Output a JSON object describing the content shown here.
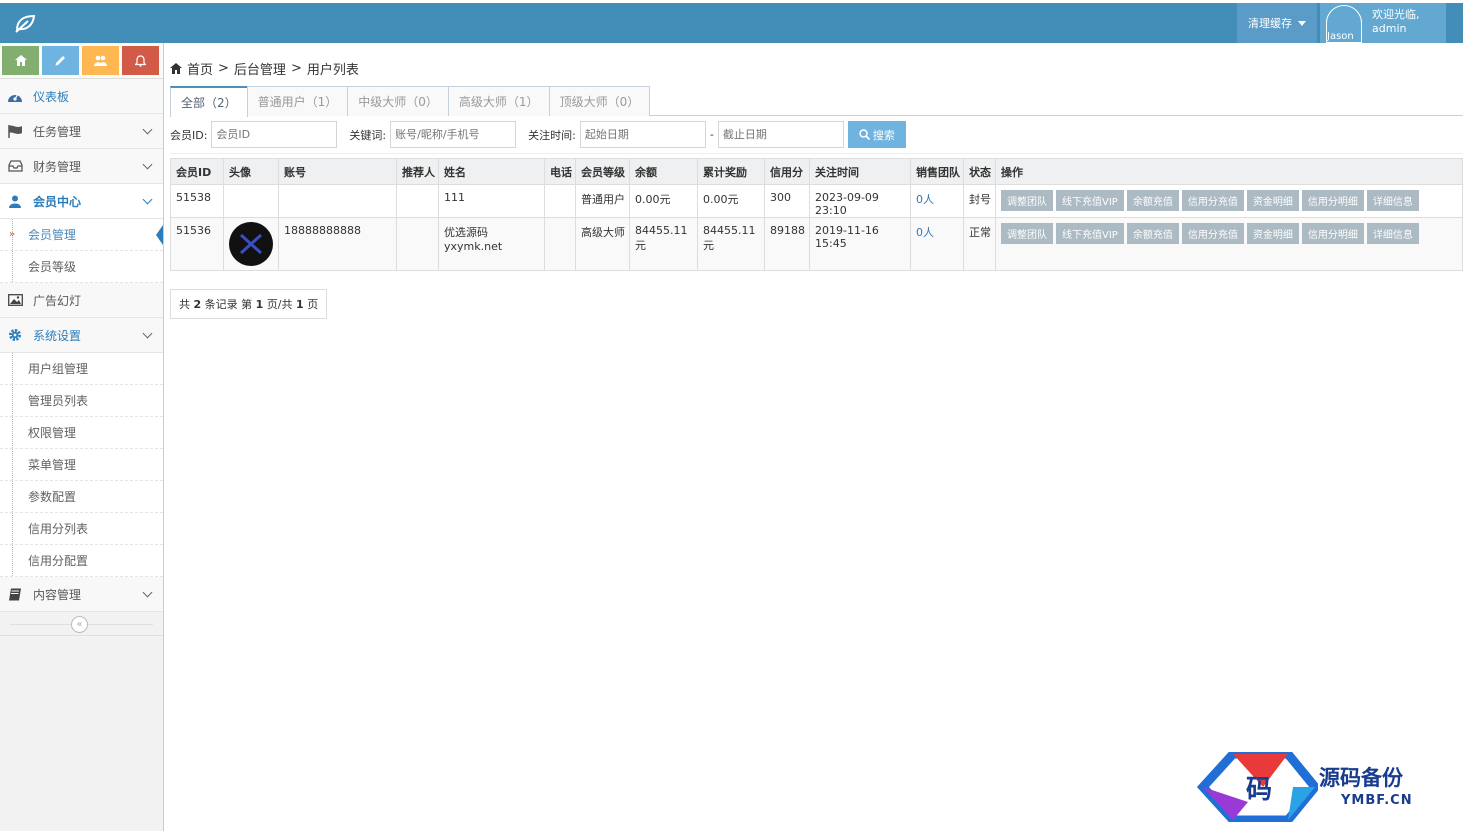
{
  "navbar": {
    "cache_label": "清理缓存",
    "avatar_name": "Jason",
    "welcome": "欢迎光临,",
    "username": "admin"
  },
  "sidebar": {
    "items": [
      {
        "label": "仪表板"
      },
      {
        "label": "任务管理"
      },
      {
        "label": "财务管理"
      },
      {
        "label": "会员中心"
      },
      {
        "label": "广告幻灯"
      },
      {
        "label": "系统设置"
      },
      {
        "label": "内容管理"
      }
    ],
    "member_sub": [
      "会员管理",
      "会员等级"
    ],
    "system_sub": [
      "用户组管理",
      "管理员列表",
      "权限管理",
      "菜单管理",
      "参数配置",
      "信用分列表",
      "信用分配置"
    ]
  },
  "breadcrumb": [
    "首页",
    "后台管理",
    "用户列表"
  ],
  "tabs": [
    "全部（2）",
    "普通用户（1）",
    "中级大师（0）",
    "高级大师（1）",
    "顶级大师（0）"
  ],
  "search": {
    "id_label": "会员ID:",
    "id_placeholder": "会员ID",
    "kw_label": "关键词:",
    "kw_placeholder": "账号/昵称/手机号",
    "time_label": "关注时间:",
    "start_placeholder": "起始日期",
    "dash": "-",
    "end_placeholder": "截止日期",
    "button": "搜索"
  },
  "table": {
    "headers": [
      "会员ID",
      "头像",
      "账号",
      "推荐人",
      "姓名",
      "电话",
      "会员等级",
      "余额",
      "累计奖励",
      "信用分",
      "关注时间",
      "销售团队",
      "状态",
      "操作"
    ],
    "rows": [
      {
        "id": "51538",
        "account": "",
        "referrer": "",
        "name": "111",
        "phone": "",
        "level": "普通用户",
        "balance": "0.00元",
        "reward": "0.00元",
        "credit": "300",
        "time": "2023-09-09 23:10",
        "team": "0人",
        "status": "封号"
      },
      {
        "id": "51536",
        "account": "18888888888",
        "referrer": "",
        "name": "优选源码yxymk.net",
        "phone": "",
        "level": "高级大师",
        "balance": "84455.11元",
        "reward": "84455.11元",
        "credit": "89188",
        "time": "2019-11-16 15:45",
        "team": "0人",
        "status": "正常"
      }
    ],
    "ops": [
      "调整团队",
      "线下充值VIP",
      "余额充值",
      "信用分充值",
      "资金明细",
      "信用分明细",
      "详细信息"
    ]
  },
  "pager": {
    "prefix": "共",
    "total": "2",
    "mid1": "条记录 第",
    "page": "1",
    "mid2": "页/共",
    "pages": "1",
    "suffix": "页"
  },
  "watermark": {
    "main": "源码备份",
    "sub": "YMBF.CN",
    "glyph": "码"
  }
}
